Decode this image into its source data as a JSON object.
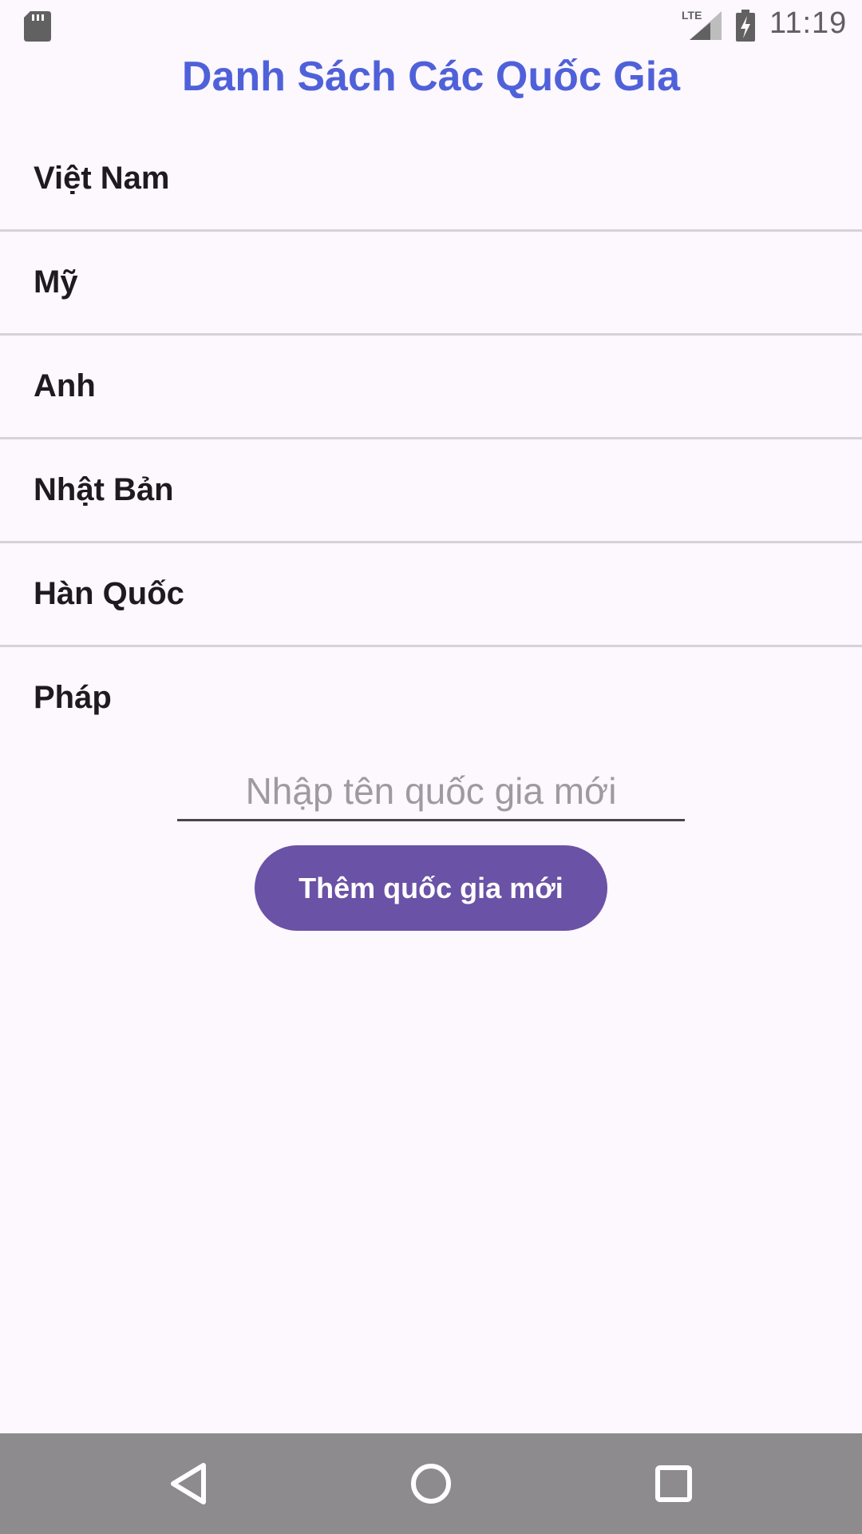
{
  "status_bar": {
    "time": "11:19",
    "network": "LTE",
    "icons": [
      "sd-card-icon",
      "lte-signal-icon",
      "battery-charging-icon"
    ]
  },
  "title": "Danh Sách Các Quốc Gia",
  "countries": [
    "Việt Nam",
    "Mỹ",
    "Anh",
    "Nhật Bản",
    "Hàn Quốc",
    "Pháp"
  ],
  "input": {
    "placeholder": "Nhập tên quốc gia mới",
    "value": ""
  },
  "add_button_label": "Thêm quốc gia mới",
  "nav_bar": {
    "icons": [
      "back-icon",
      "home-icon",
      "recent-apps-icon"
    ]
  },
  "colors": {
    "title": "#4f61d9",
    "button": "#6a52a6",
    "background": "#fdf7fe",
    "nav_bar": "#8d8b8e"
  }
}
